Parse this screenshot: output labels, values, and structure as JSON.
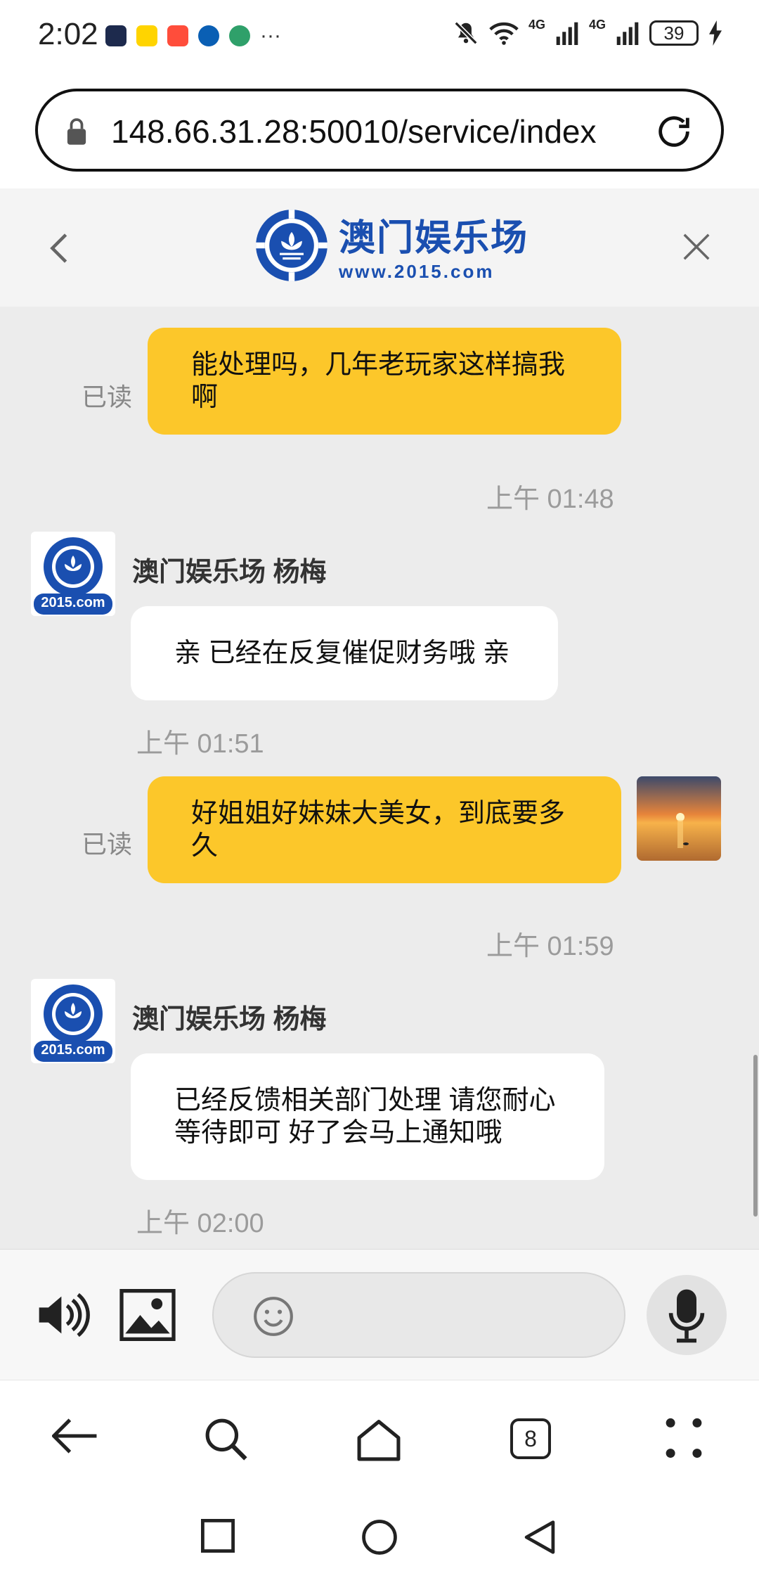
{
  "status": {
    "time": "2:02",
    "more": "···",
    "network1": "4G",
    "network2": "4G",
    "battery": "39"
  },
  "browser": {
    "url": "148.66.31.28:50010/service/index"
  },
  "header": {
    "brand_name": "澳门娱乐场",
    "brand_url": "www.2015.com"
  },
  "messages": [
    {
      "from": "me",
      "text": "能处理吗，几年老玩家这样搞我啊",
      "status": "已读",
      "time": "上午 01:48"
    },
    {
      "from": "agent",
      "sender": "澳门娱乐场 杨梅",
      "avatar_text": "2015.com",
      "text": "亲 已经在反复催促财务哦 亲",
      "time": "上午 01:51"
    },
    {
      "from": "me",
      "text": "好姐姐好妹妹大美女，到底要多久",
      "status": "已读",
      "time": "上午 01:59"
    },
    {
      "from": "agent",
      "sender": "澳门娱乐场 杨梅",
      "avatar_text": "2015.com",
      "text": "已经反馈相关部门处理 请您耐心等待即可 好了会马上通知哦",
      "time": "上午 02:00"
    }
  ],
  "input": {
    "placeholder": ""
  },
  "nav": {
    "tab_count": "8"
  },
  "colors": {
    "my_bubble": "#fcc72a",
    "agent_bubble": "#ffffff",
    "brand_blue": "#1a4fb0"
  }
}
